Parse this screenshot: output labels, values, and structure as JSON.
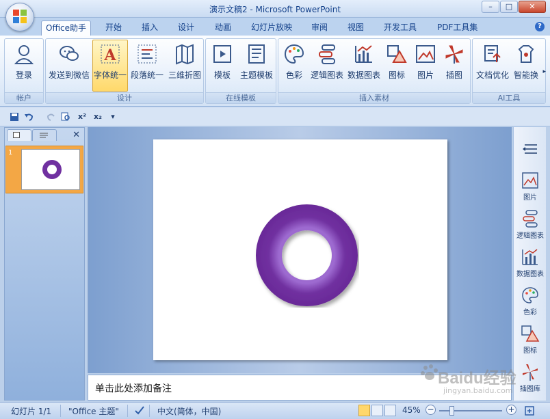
{
  "window": {
    "title": "演示文稿2 - Microsoft PowerPoint",
    "controls": [
      "–",
      "□",
      "✕"
    ]
  },
  "tabs": [
    "Office助手",
    "开始",
    "插入",
    "设计",
    "动画",
    "幻灯片放映",
    "审阅",
    "视图",
    "开发工具",
    "PDF工具集"
  ],
  "help_icon": "?",
  "ribbon": {
    "groups": [
      {
        "label": "帐户",
        "buttons": [
          {
            "label": "登录",
            "icon": "user-icon"
          }
        ]
      },
      {
        "label": "设计",
        "buttons": [
          {
            "label": "发送到微信",
            "icon": "wechat-icon"
          },
          {
            "label": "字体统一",
            "icon": "font-a-icon",
            "selected": true
          },
          {
            "label": "段落统一",
            "icon": "paragraph-icon"
          },
          {
            "label": "三维折图",
            "icon": "fold-map-icon"
          }
        ]
      },
      {
        "label": "在线模板",
        "buttons": [
          {
            "label": "模板",
            "icon": "template-icon"
          },
          {
            "label": "主题模板",
            "icon": "theme-template-icon"
          }
        ]
      },
      {
        "label": "插入素材",
        "buttons": [
          {
            "label": "色彩",
            "icon": "palette-icon"
          },
          {
            "label": "逻辑图表",
            "icon": "logic-chart-icon"
          },
          {
            "label": "数据图表",
            "icon": "data-chart-icon"
          },
          {
            "label": "图标",
            "icon": "shapes-icon"
          },
          {
            "label": "图片",
            "icon": "picture-icon"
          },
          {
            "label": "插图",
            "icon": "windmill-icon"
          }
        ]
      },
      {
        "label": "AI工具",
        "buttons": [
          {
            "label": "文档优化",
            "icon": "doc-optimize-icon"
          },
          {
            "label": "智能换",
            "icon": "smart-swap-icon"
          }
        ]
      }
    ],
    "more_arrow": "▸"
  },
  "qat": {
    "superscript": "x²",
    "subscript": "x₂",
    "customize": "▾"
  },
  "leftpane": {
    "close": "✕",
    "slides": [
      {
        "number": "1"
      }
    ]
  },
  "notes": {
    "placeholder": "单击此处添加备注"
  },
  "rightbar": [
    {
      "label": "",
      "icon": "collapse-icon"
    },
    {
      "label": "图片",
      "icon": "picture-icon"
    },
    {
      "label": "逻辑图表",
      "icon": "logic-chart-icon"
    },
    {
      "label": "数据图表",
      "icon": "data-chart-icon"
    },
    {
      "label": "色彩",
      "icon": "palette-icon"
    },
    {
      "label": "图标",
      "icon": "shapes-icon"
    },
    {
      "label": "插图库",
      "icon": "windmill-icon"
    }
  ],
  "status": {
    "slide_info": "幻灯片 1/1",
    "theme": "\"Office 主题\"",
    "language": "中文(简体，中国)",
    "zoom": "45%",
    "zoom_minus": "−",
    "zoom_plus": "+"
  },
  "colors": {
    "donut": "#7030a0",
    "accent": "#15428b",
    "selected": "#ffd96b"
  },
  "watermark": {
    "brand": "Baidu经验",
    "url": "jingyan.baidu.com"
  }
}
